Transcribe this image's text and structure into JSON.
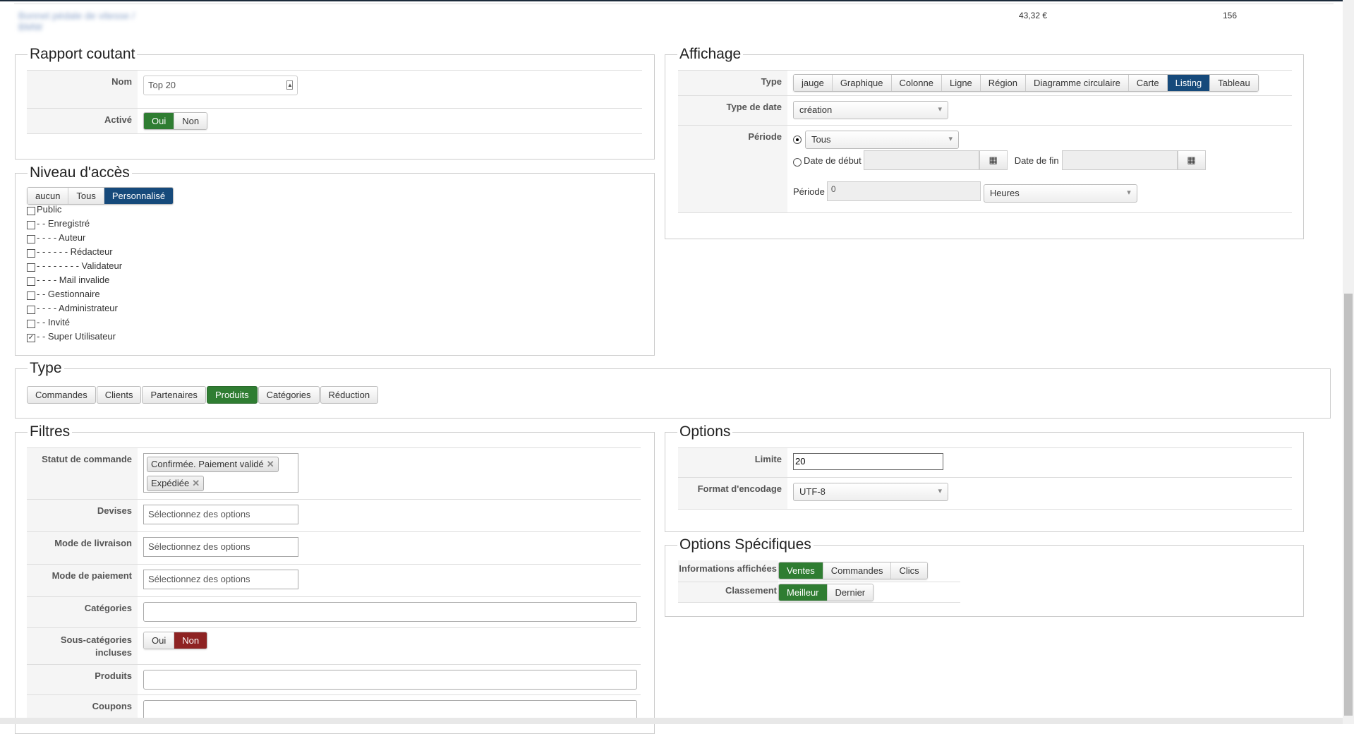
{
  "top": {
    "blurred": "Bonnet pédale de vitesse / BMW",
    "price": "43,32 €",
    "count": "156"
  },
  "rapport": {
    "legend": "Rapport coutant",
    "nom_label": "Nom",
    "nom_value": "Top 20",
    "active_label": "Activé",
    "active_options": [
      "Oui",
      "Non"
    ]
  },
  "niveau": {
    "legend": "Niveau d'accès",
    "modes": [
      "aucun",
      "Tous",
      "Personnalisé"
    ],
    "groups": [
      "Public",
      "- - Enregistré",
      "- - - - Auteur",
      "- - - - - - Rédacteur",
      "- - - - - - - - Validateur",
      "- - - - Mail invalide",
      "- - Gestionnaire",
      "- - - - Administrateur",
      "- - Invité",
      "- - Super Utilisateur"
    ]
  },
  "type": {
    "legend": "Type",
    "options": [
      "Commandes",
      "Clients",
      "Partenaires",
      "Produits",
      "Catégories",
      "Réduction"
    ]
  },
  "filtres": {
    "legend": "Filtres",
    "statut_label": "Statut de commande",
    "statut_tags": [
      "Confirmée. Paiement validé",
      "Expédiée"
    ],
    "devises_label": "Devises",
    "livraison_label": "Mode de livraison",
    "paiement_label": "Mode de paiement",
    "placeholder": "Sélectionnez des options",
    "categories_label": "Catégories",
    "souscat_label": "Sous-catégories incluses",
    "souscat_options": [
      "Oui",
      "Non"
    ],
    "produits_label": "Produits",
    "coupons_label": "Coupons"
  },
  "affichage": {
    "legend": "Affichage",
    "type_label": "Type",
    "types": [
      "jauge",
      "Graphique",
      "Colonne",
      "Ligne",
      "Région",
      "Diagramme circulaire",
      "Carte",
      "Listing",
      "Tableau"
    ],
    "datetype_label": "Type de date",
    "datetype_value": "création",
    "periode_label": "Période",
    "periode_value": "Tous",
    "debut_label": "Date de début",
    "fin_label": "Date de fin",
    "periode2_label": "Période",
    "periode2_value": "0",
    "unit_value": "Heures"
  },
  "options": {
    "legend": "Options",
    "limite_label": "Limite",
    "limite_value": "20",
    "format_label": "Format d'encodage",
    "format_value": "UTF-8"
  },
  "specifiques": {
    "legend": "Options Spécifiques",
    "info_label": "Informations affichées",
    "info_options": [
      "Ventes",
      "Commandes",
      "Clics"
    ],
    "classement_label": "Classement",
    "classement_options": [
      "Meilleur",
      "Dernier"
    ]
  }
}
